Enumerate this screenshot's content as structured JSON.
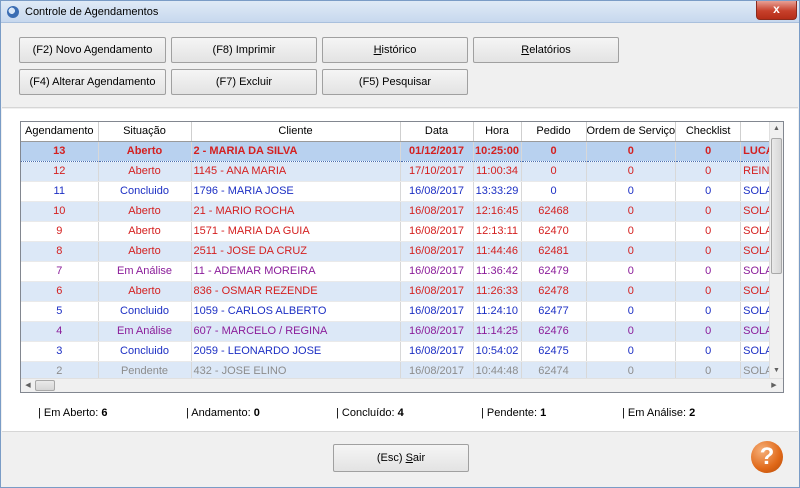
{
  "window": {
    "title": "Controle de Agendamentos",
    "close_glyph": "x"
  },
  "toolbar": {
    "buttons": [
      {
        "pre": "(F2) Novo Agendamento",
        "ul": "",
        "post": ""
      },
      {
        "pre": "(F8) Imprimir",
        "ul": "",
        "post": ""
      },
      {
        "pre": "",
        "ul": "H",
        "post": "istórico"
      },
      {
        "pre": "",
        "ul": "R",
        "post": "elatórios"
      },
      {
        "pre": "(F4) Alterar Agendamento",
        "ul": "",
        "post": ""
      },
      {
        "pre": "(F7) Excluir",
        "ul": "",
        "post": ""
      },
      {
        "pre": "(F5) Pesquisar",
        "ul": "",
        "post": ""
      }
    ]
  },
  "grid": {
    "columns": [
      "Agendamento",
      "Situação",
      "Cliente",
      "Data",
      "Hora",
      "Pedido",
      "Ordem de Serviço",
      "Checklist",
      ""
    ],
    "rows": [
      {
        "ag": "13",
        "sit": "Aberto",
        "cli": "2 - MARIA DA SILVA",
        "data": "01/12/2017",
        "hora": "10:25:00",
        "ped": "0",
        "os": "0",
        "chk": "0",
        "resp": "LUCA",
        "color": "#d42020",
        "selected": true
      },
      {
        "ag": "12",
        "sit": "Aberto",
        "cli": "1145 - ANA MARIA",
        "data": "17/10/2017",
        "hora": "11:00:34",
        "ped": "0",
        "os": "0",
        "chk": "0",
        "resp": "REINA",
        "color": "#d42020"
      },
      {
        "ag": "11",
        "sit": "Concluido",
        "cli": "1796 - MARIA JOSE",
        "data": "16/08/2017",
        "hora": "13:33:29",
        "ped": "0",
        "os": "0",
        "chk": "0",
        "resp": "SOLA",
        "color": "#1c2fc4"
      },
      {
        "ag": "10",
        "sit": "Aberto",
        "cli": "21 - MARIO ROCHA",
        "data": "16/08/2017",
        "hora": "12:16:45",
        "ped": "62468",
        "os": "0",
        "chk": "0",
        "resp": "SOLA",
        "color": "#d42020"
      },
      {
        "ag": "9",
        "sit": "Aberto",
        "cli": "1571 - MARIA DA GUIA",
        "data": "16/08/2017",
        "hora": "12:13:11",
        "ped": "62470",
        "os": "0",
        "chk": "0",
        "resp": "SOLA",
        "color": "#d42020"
      },
      {
        "ag": "8",
        "sit": "Aberto",
        "cli": "2511 - JOSE DA CRUZ",
        "data": "16/08/2017",
        "hora": "11:44:46",
        "ped": "62481",
        "os": "0",
        "chk": "0",
        "resp": "SOLA",
        "color": "#d42020"
      },
      {
        "ag": "7",
        "sit": "Em Análise",
        "cli": "11 - ADEMAR MOREIRA",
        "data": "16/08/2017",
        "hora": "11:36:42",
        "ped": "62479",
        "os": "0",
        "chk": "0",
        "resp": "SOLA",
        "color": "#8a1c9a"
      },
      {
        "ag": "6",
        "sit": "Aberto",
        "cli": "836 - OSMAR REZENDE",
        "data": "16/08/2017",
        "hora": "11:26:33",
        "ped": "62478",
        "os": "0",
        "chk": "0",
        "resp": "SOLA",
        "color": "#d42020"
      },
      {
        "ag": "5",
        "sit": "Concluido",
        "cli": "1059 - CARLOS ALBERTO",
        "data": "16/08/2017",
        "hora": "11:24:10",
        "ped": "62477",
        "os": "0",
        "chk": "0",
        "resp": "SOLA",
        "color": "#1c2fc4"
      },
      {
        "ag": "4",
        "sit": "Em Análise",
        "cli": "607 - MARCELO / REGINA",
        "data": "16/08/2017",
        "hora": "11:14:25",
        "ped": "62476",
        "os": "0",
        "chk": "0",
        "resp": "SOLA",
        "color": "#8a1c9a"
      },
      {
        "ag": "3",
        "sit": "Concluido",
        "cli": "2059 - LEONARDO JOSE",
        "data": "16/08/2017",
        "hora": "10:54:02",
        "ped": "62475",
        "os": "0",
        "chk": "0",
        "resp": "SOLA",
        "color": "#1c2fc4"
      },
      {
        "ag": "2",
        "sit": "Pendente",
        "cli": "432 - JOSE ELINO",
        "data": "16/08/2017",
        "hora": "10:44:48",
        "ped": "62474",
        "os": "0",
        "chk": "0",
        "resp": "SOLA",
        "color": "#8c8c8c"
      }
    ]
  },
  "status": [
    {
      "label": "| Em Aberto:",
      "value": "6"
    },
    {
      "label": "| Andamento:",
      "value": "0"
    },
    {
      "label": "| Concluído:",
      "value": "4"
    },
    {
      "label": "| Pendente:",
      "value": "1"
    },
    {
      "label": "| Em Análise:",
      "value": "2"
    }
  ],
  "footer": {
    "exit_pre": "(Esc) ",
    "exit_ul": "S",
    "exit_post": "air",
    "help_glyph": "?"
  },
  "colors": {
    "aberto": "#d42020",
    "concluido": "#1c2fc4",
    "em_analise": "#8a1c9a",
    "pendente": "#8c8c8c",
    "help": "#e06818"
  },
  "icons": {
    "app": "calendar-app-icon",
    "close": "close-icon",
    "help": "help-icon"
  }
}
